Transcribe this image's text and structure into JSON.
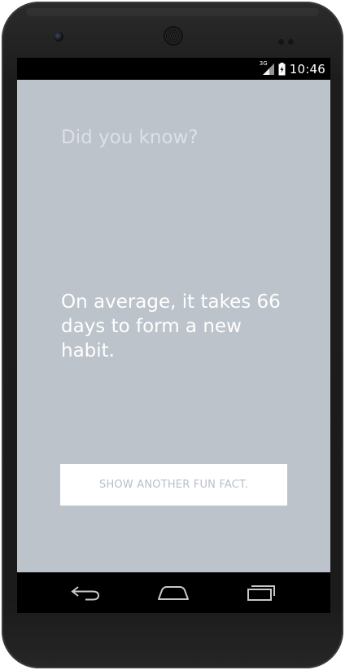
{
  "status_bar": {
    "network_label": "3G",
    "time": "10:46",
    "icons": [
      "signal-icon",
      "battery-icon"
    ]
  },
  "app": {
    "heading": "Did you know?",
    "fact": "On average, it takes 66 days to form a new habit.",
    "button_label": "SHOW ANOTHER FUN FACT.",
    "colors": {
      "background": "#bcc3cb",
      "heading": "#dde1e6",
      "fact_text": "#ffffff",
      "button_background": "#ffffff",
      "button_text": "#b8bfc8"
    }
  },
  "navigation": {
    "icons": [
      "back-icon",
      "home-icon",
      "recents-icon"
    ]
  }
}
